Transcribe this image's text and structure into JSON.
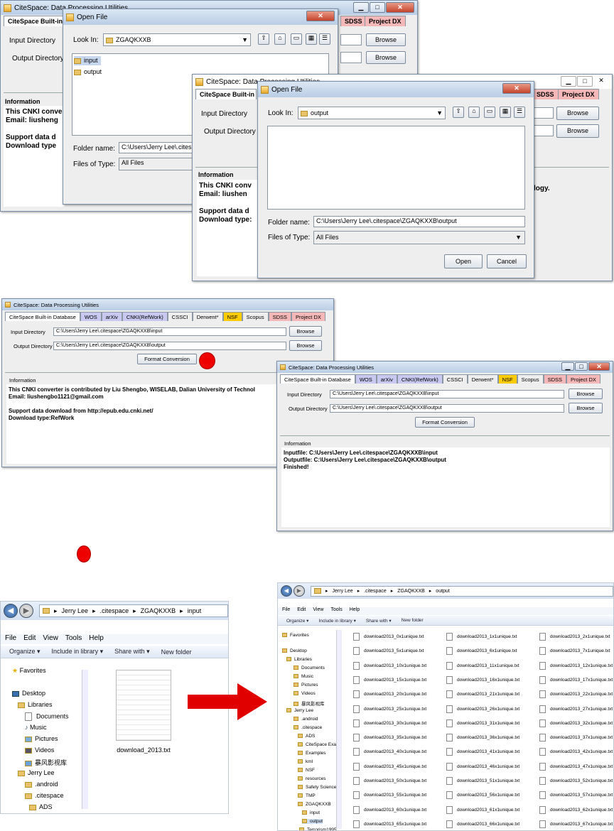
{
  "app_title": "CiteSpace: Data Processing Utilities",
  "tabs": [
    "CiteSpace Built-in Database",
    "WOS",
    "arXiv",
    "CNKI(RefWork)",
    "CSSCI",
    "Derwent*",
    "NSF",
    "Scopus",
    "SDSS",
    "Project DX"
  ],
  "tab_colors": {
    "WOS": "#c8c8f0",
    "arXiv": "#c8c8f0",
    "CNKI(RefWork)": "#c8c8f0",
    "NSF": "#ffcc00",
    "SDSS": "#f4b8b8",
    "Project DX": "#f4b8b8"
  },
  "labels": {
    "input_dir": "Input Directory",
    "output_dir": "Output Directory",
    "browse": "Browse",
    "format_conversion": "Format Conversion",
    "information": "Information"
  },
  "window1": {
    "tabs_visible": [
      "CiteSpace Built-in",
      "SDSS",
      "Project DX"
    ],
    "info_lines": "This CNKI conver\nEmail: liusheng\n\nSupport data d\nDownload type"
  },
  "dialog1": {
    "title": "Open File",
    "look_in_label": "Look In:",
    "look_in_value": "ZGAQKXXB",
    "folders": [
      "input",
      "output"
    ],
    "folder_name_label": "Folder name:",
    "folder_name_value": "C:\\Users\\Jerry Lee\\.cites",
    "files_type_label": "Files of Type:",
    "files_type_value": "All Files"
  },
  "window2": {
    "tabs_visible": [
      "CiteSpace Built-in D",
      "SDSS",
      "Project DX"
    ],
    "input_label": "Input Directory",
    "output_label": "Output Directory",
    "info_lines": "This CNKI conv\nEmail: liushen\n\nSupport data d\nDownload type:",
    "info_tail": "logy."
  },
  "dialog2": {
    "title": "Open File",
    "look_in_label": "Look In:",
    "look_in_value": "output",
    "folder_name_label": "Folder name:",
    "folder_name_value": "C:\\Users\\Jerry Lee\\.citespace\\ZGAQKXXB\\output",
    "files_type_label": "Files of Type:",
    "files_type_value": "All Files",
    "open": "Open",
    "cancel": "Cancel"
  },
  "window3": {
    "input_value": "C:\\Users\\Jerry Lee\\.citespace\\ZGAQKXXB\\input",
    "output_value": "C:\\Users\\Jerry Lee\\.citespace\\ZGAQKXXB\\output",
    "info_lines": "This CNKI converter is contributed by Liu Shengbo, WISELAB, Dalian University of Technol\nEmail: liushengbo1121@gmail.com\n\nSupport data download from http://epub.edu.cnki.net/\nDownload type:RefWork"
  },
  "window4": {
    "input_value": "C:\\Users\\Jerry Lee\\.citespace\\ZGAQKXXB\\input",
    "output_value": "C:\\Users\\Jerry Lee\\.citespace\\ZGAQKXXB\\output",
    "info_lines": "Inputfile: C:\\Users\\Jerry Lee\\.citespace\\ZGAQKXXB\\input\nOutputfile: C:\\Users\\Jerry Lee\\.citespace\\ZGAQKXXB\\output\nFinished!"
  },
  "explorer1": {
    "breadcrumb": [
      "Jerry Lee",
      "▸",
      ".citespace",
      "▸",
      "ZGAQKXXB",
      "▸",
      "input"
    ],
    "menu": [
      "File",
      "Edit",
      "View",
      "Tools",
      "Help"
    ],
    "commands": [
      "Organize ▾",
      "Include in library ▾",
      "Share with ▾",
      "New folder"
    ],
    "tree": [
      "Favorites",
      "Desktop",
      "Libraries",
      "Documents",
      "Music",
      "Pictures",
      "Videos",
      "暴风影视库",
      "Jerry Lee",
      ".android",
      ".citespace",
      "ADS"
    ],
    "file": "download_2013.txt"
  },
  "explorer2": {
    "breadcrumb": [
      "Jerry Lee",
      "▸",
      ".citespace",
      "▸",
      "ZGAQKXXB",
      "▸",
      "output"
    ],
    "menu": [
      "File",
      "Edit",
      "View",
      "Tools",
      "Help"
    ],
    "commands": [
      "Organize ▾",
      "Include in library ▾",
      "Share with ▾",
      "New folder"
    ],
    "tree": [
      "Favorites",
      "Desktop",
      "Libraries",
      "Documents",
      "Music",
      "Pictures",
      "Videos",
      "暴风影视库",
      "Jerry Lee",
      ".android",
      ".citespace",
      "ADS",
      "CiteSpace Exa",
      "Examples",
      "kml",
      "NSF",
      "resources",
      "Safety Science",
      "TMP",
      "ZGAQKXXB",
      "input",
      "output",
      "Terrorism1995"
    ],
    "files": [
      [
        "download2013_0x1unique.txt",
        "download2013_1x1unique.txt",
        "download2013_2x1unique.txt"
      ],
      [
        "download2013_5x1unique.txt",
        "download2013_6x1unique.txt",
        "download2013_7x1unique.txt"
      ],
      [
        "download2013_10x1unique.txt",
        "download2013_11x1unique.txt",
        "download2013_12x1unique.txt"
      ],
      [
        "download2013_15x1unique.txt",
        "download2013_16x1unique.txt",
        "download2013_17x1unique.txt"
      ],
      [
        "download2013_20x1unique.txt",
        "download2013_21x1unique.txt",
        "download2013_22x1unique.txt"
      ],
      [
        "download2013_25x1unique.txt",
        "download2013_26x1unique.txt",
        "download2013_27x1unique.txt"
      ],
      [
        "download2013_30x1unique.txt",
        "download2013_31x1unique.txt",
        "download2013_32x1unique.txt"
      ],
      [
        "download2013_35x1unique.txt",
        "download2013_36x1unique.txt",
        "download2013_37x1unique.txt"
      ],
      [
        "download2013_40x1unique.txt",
        "download2013_41x1unique.txt",
        "download2013_42x1unique.txt"
      ],
      [
        "download2013_45x1unique.txt",
        "download2013_46x1unique.txt",
        "download2013_47x1unique.txt"
      ],
      [
        "download2013_50x1unique.txt",
        "download2013_51x1unique.txt",
        "download2013_52x1unique.txt"
      ],
      [
        "download2013_55x1unique.txt",
        "download2013_56x1unique.txt",
        "download2013_57x1unique.txt"
      ],
      [
        "download2013_60x1unique.txt",
        "download2013_61x1unique.txt",
        "download2013_62x1unique.txt"
      ],
      [
        "download2013_65x1unique.txt",
        "download2013_66x1unique.txt",
        "download2013_67x1unique.txt"
      ]
    ]
  },
  "colors": {
    "accent_red": "#ee0000",
    "arrow_red": "#e00000",
    "title_blue": "#c4d6ee"
  }
}
